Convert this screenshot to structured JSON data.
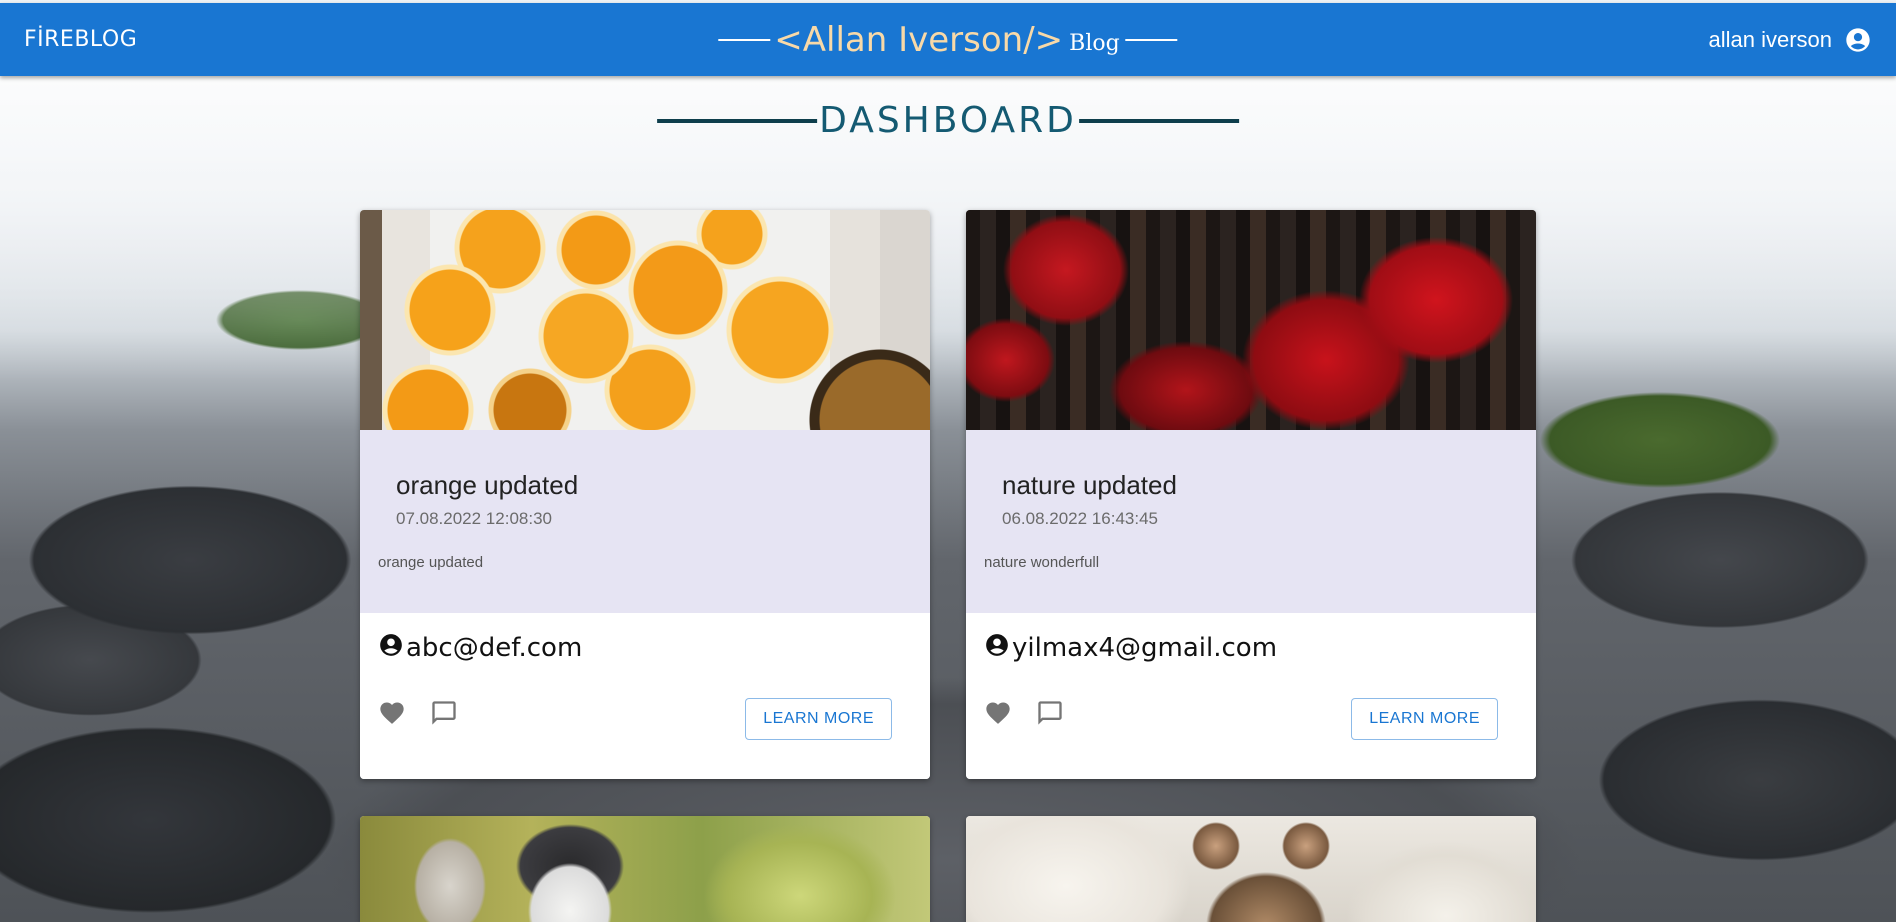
{
  "navbar": {
    "brand": "FİREBLOG",
    "title_main": "<Allan Iverson/>",
    "title_suffix": "Blog",
    "user_name": "allan iverson",
    "user_icon": "account-circle-icon"
  },
  "page": {
    "heading": "DASHBOARD"
  },
  "posts": [
    {
      "title": "orange updated",
      "date": "07.08.2022 12:08:30",
      "excerpt": "orange updated",
      "author": "abc@def.com",
      "image": "oranges-photo",
      "button": "LEARN MORE"
    },
    {
      "title": "nature updated",
      "date": "06.08.2022 16:43:45",
      "excerpt": "nature wonderfull",
      "author": "yilmax4@gmail.com",
      "image": "red-forest-photo",
      "button": "LEARN MORE"
    },
    {
      "image": "husky-dog-photo"
    },
    {
      "image": "tabby-cat-photo"
    }
  ],
  "icons": {
    "favorite": "heart-icon",
    "comment": "comment-icon",
    "author": "account-circle-icon"
  },
  "colors": {
    "appbar": "#1976d2",
    "card_body": "#e6e4f3",
    "heading": "#145a72",
    "button_text": "#1976d2"
  }
}
